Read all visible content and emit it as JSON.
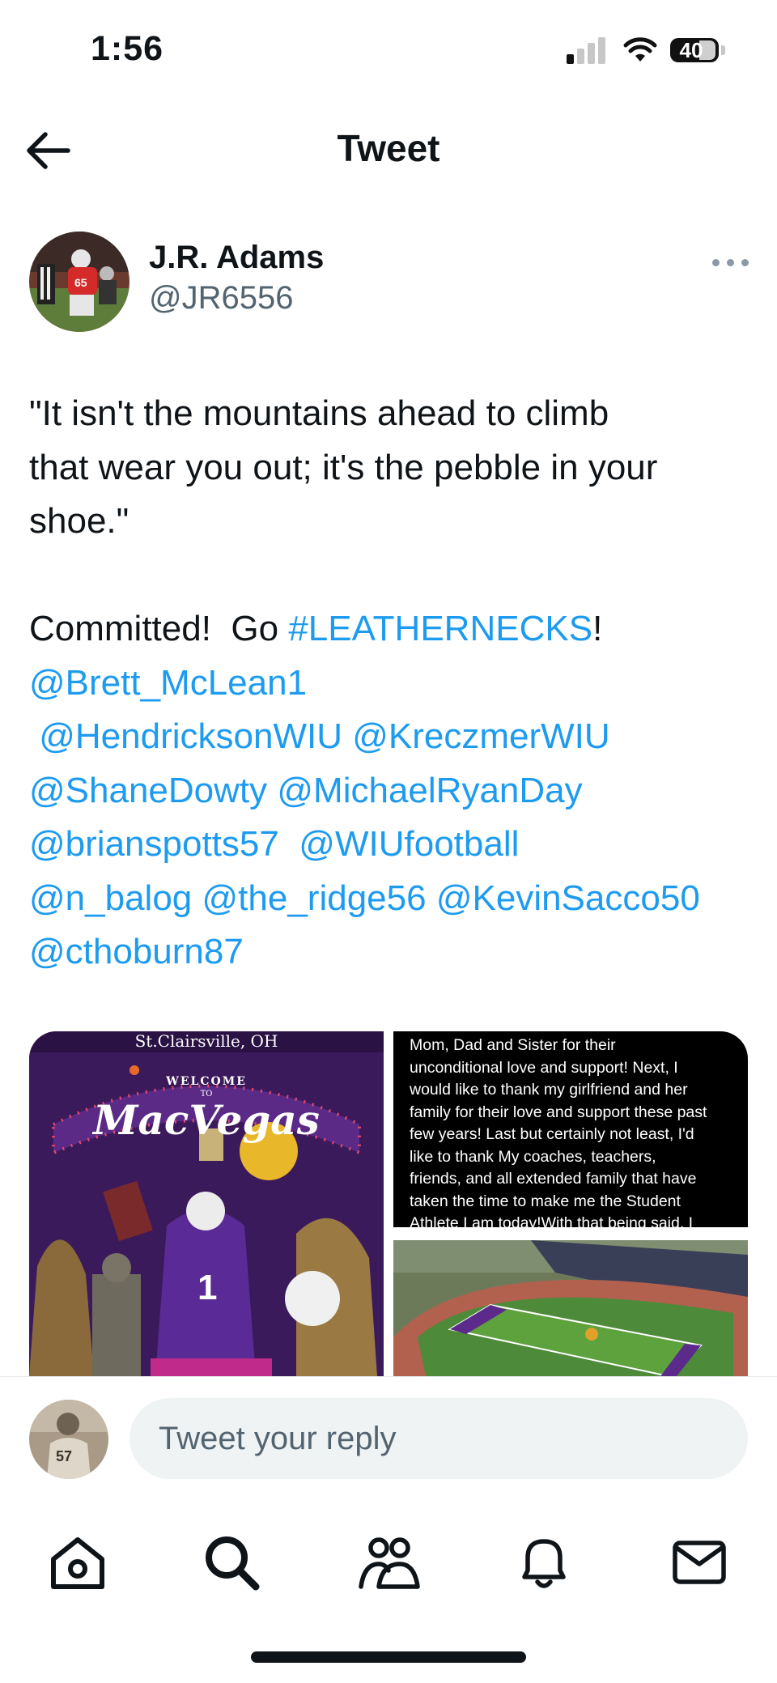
{
  "status_bar": {
    "time": "1:56",
    "battery": "40"
  },
  "header": {
    "title": "Tweet"
  },
  "author": {
    "name": "J.R. Adams",
    "handle": "@JR6556"
  },
  "tweet": {
    "line1": "\"It isn't the mountains ahead to climb",
    "line2": "that wear you out; it's the pebble in your",
    "line3": "shoe.\"",
    "committed_prefix": "Committed!  Go ",
    "hashtag": "#LEATHERNECKS",
    "committed_suffix": "!",
    "mentions": [
      "@Brett_McLean1",
      "@HendricksonWIU",
      "@KreczmerWIU",
      "@ShaneDowty",
      "@MichaelRyanDay",
      "@brianspotts57",
      "@WIUfootball",
      "@n_balog",
      "@the_ridge56",
      "@KevinSacco50",
      "@cthoburn87"
    ]
  },
  "media": {
    "left_location": "St.Clairsville, OH",
    "left_welcome": "WELCOME",
    "left_to": "TO",
    "left_title": "MacVegas",
    "left_jersey_number": "1",
    "note_lines": [
      "Mom, Dad and Sister for their",
      "unconditional love and support! Next, I",
      "would like to thank my girlfriend and her",
      "family for their love and support these past",
      "few years! Last but certainly not least, I'd",
      "like to thank My  coaches, teachers,",
      "friends, and all extended family that have",
      "taken the time to make me the Student",
      "Athlete I am today!With that being said, I"
    ]
  },
  "reply": {
    "placeholder": "Tweet your reply",
    "avatar_number": "57"
  },
  "tab_bar": {
    "items": [
      "home-icon",
      "search-icon",
      "communities-icon",
      "notifications-icon",
      "messages-icon"
    ]
  },
  "colors": {
    "link": "#1d9bf0",
    "text": "#0f1419",
    "secondary": "#536471",
    "reply_bg": "#eff3f4"
  }
}
